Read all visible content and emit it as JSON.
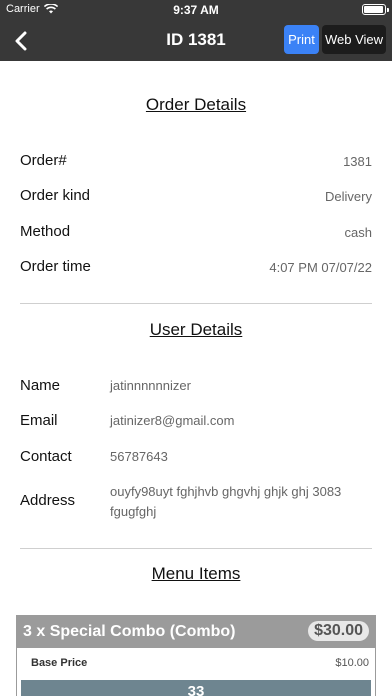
{
  "status_bar": {
    "carrier": "Carrier",
    "time": "9:37 AM"
  },
  "nav": {
    "title": "ID 1381",
    "print_label": "Print",
    "web_view_label": "Web View"
  },
  "order_details": {
    "title": "Order Details",
    "rows": [
      {
        "label": "Order#",
        "value": "1381"
      },
      {
        "label": "Order kind",
        "value": "Delivery"
      },
      {
        "label": "Method",
        "value": "cash"
      },
      {
        "label": "Order time",
        "value": "4:07 PM 07/07/22"
      }
    ]
  },
  "user_details": {
    "title": "User Details",
    "rows": [
      {
        "label": "Name",
        "value": "jatinnnnnnizer"
      },
      {
        "label": "Email",
        "value": "jatinizer8@gmail.com"
      },
      {
        "label": "Contact",
        "value": "56787643"
      },
      {
        "label": "Address",
        "value": "ouyfy98uyt fghjhvb ghgvhj ghjk ghj 3083 fgugfghj"
      }
    ]
  },
  "menu_items": {
    "title": "Menu Items",
    "items": [
      {
        "name": "3 x Special Combo (Combo)",
        "price": "$30.00",
        "base_price_label": "Base Price",
        "base_price_value": "$10.00",
        "quantity": "33"
      }
    ]
  },
  "colors": {
    "nav_background": "#383838",
    "print_button": "#3b82f6",
    "menu_header": "#9b9b9b",
    "quantity_bar": "#6e8590"
  }
}
